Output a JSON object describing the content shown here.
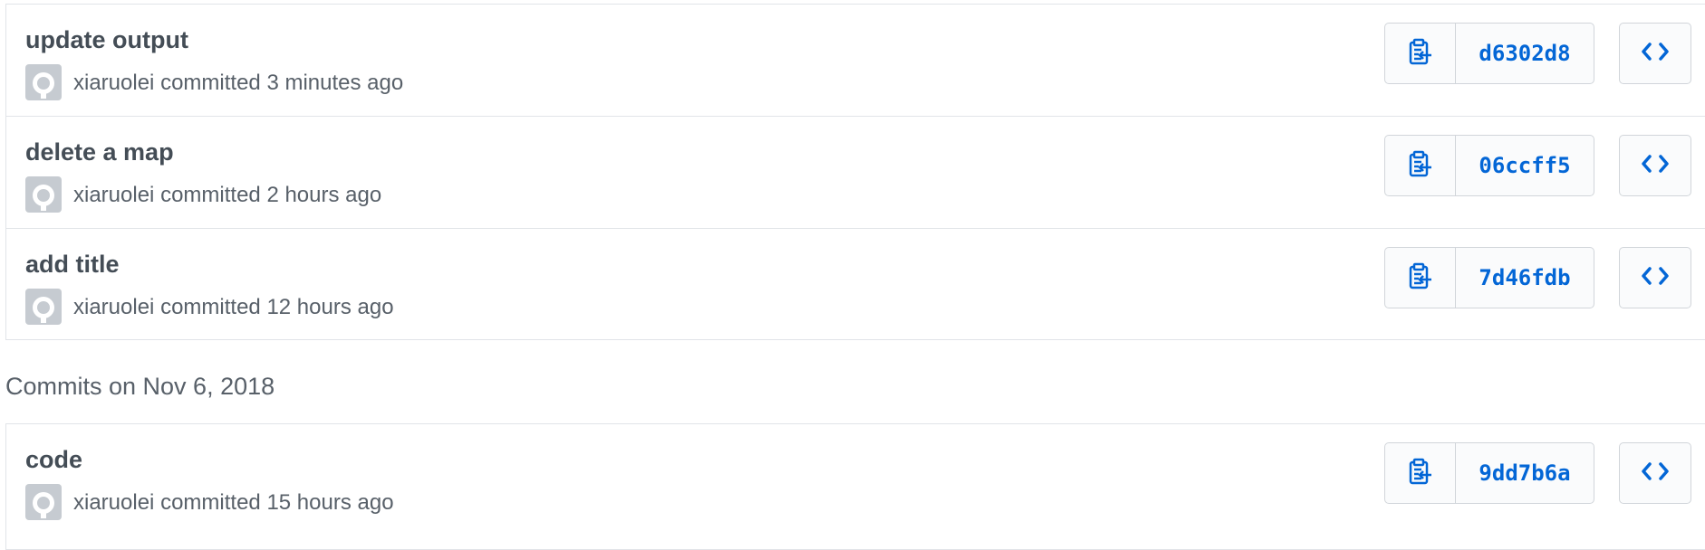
{
  "colors": {
    "link": "#0366d6",
    "title": "#444d56",
    "meta": "#586069",
    "border": "#e1e4e8",
    "avatar_bg": "#c6cbd1"
  },
  "icons": {
    "avatar": "github-octocat-icon",
    "copy": "clipboard-copy-icon",
    "browse": "code-brackets-icon"
  },
  "groups": [
    {
      "header": "",
      "commits": [
        {
          "title": "update output",
          "author": "xiaruolei",
          "action": "committed",
          "time": "3 minutes ago",
          "sha": "d6302d8"
        },
        {
          "title": "delete a map",
          "author": "xiaruolei",
          "action": "committed",
          "time": "2 hours ago",
          "sha": "06ccff5"
        },
        {
          "title": "add title",
          "author": "xiaruolei",
          "action": "committed",
          "time": "12 hours ago",
          "sha": "7d46fdb"
        }
      ]
    },
    {
      "header": "Commits on Nov 6, 2018",
      "commits": [
        {
          "title": "code",
          "author": "xiaruolei",
          "action": "committed",
          "time": "15 hours ago",
          "sha": "9dd7b6a"
        }
      ]
    }
  ]
}
